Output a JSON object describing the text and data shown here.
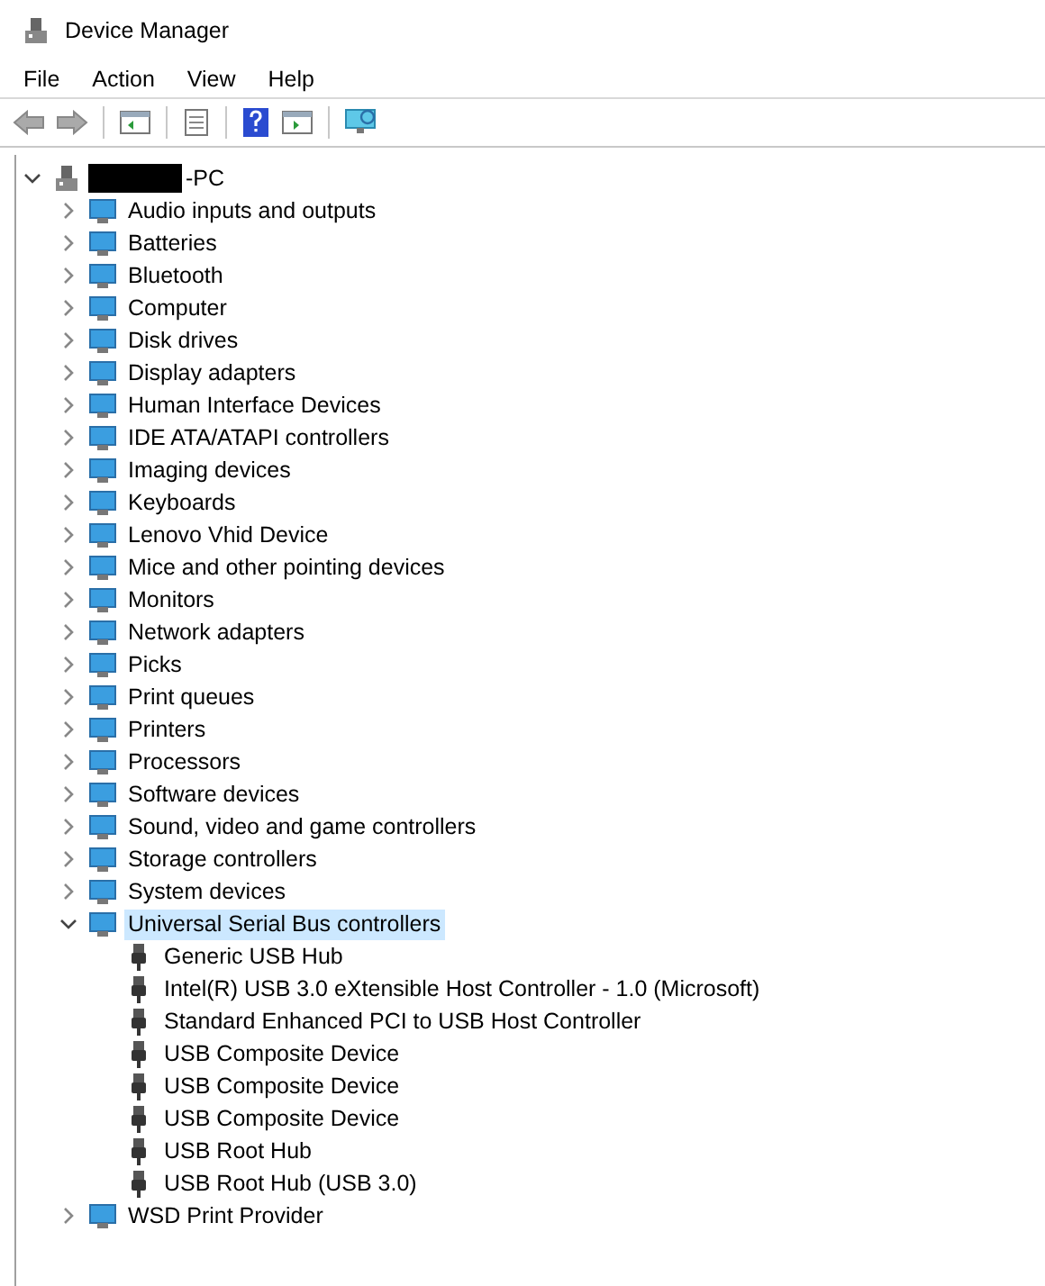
{
  "window": {
    "title": "Device Manager"
  },
  "menu": [
    "File",
    "Action",
    "View",
    "Help"
  ],
  "tree": {
    "label": "-PC",
    "redacted": true,
    "expanded": true,
    "selected": false,
    "children": [
      {
        "label": "Audio inputs and outputs",
        "expanded": false,
        "selected": false
      },
      {
        "label": "Batteries",
        "expanded": false,
        "selected": false
      },
      {
        "label": "Bluetooth",
        "expanded": false,
        "selected": false
      },
      {
        "label": "Computer",
        "expanded": false,
        "selected": false
      },
      {
        "label": "Disk drives",
        "expanded": false,
        "selected": false
      },
      {
        "label": "Display adapters",
        "expanded": false,
        "selected": false
      },
      {
        "label": "Human Interface Devices",
        "expanded": false,
        "selected": false
      },
      {
        "label": "IDE ATA/ATAPI controllers",
        "expanded": false,
        "selected": false
      },
      {
        "label": "Imaging devices",
        "expanded": false,
        "selected": false
      },
      {
        "label": "Keyboards",
        "expanded": false,
        "selected": false
      },
      {
        "label": "Lenovo Vhid Device",
        "expanded": false,
        "selected": false
      },
      {
        "label": "Mice and other pointing devices",
        "expanded": false,
        "selected": false
      },
      {
        "label": "Monitors",
        "expanded": false,
        "selected": false
      },
      {
        "label": "Network adapters",
        "expanded": false,
        "selected": false
      },
      {
        "label": "Picks",
        "expanded": false,
        "selected": false
      },
      {
        "label": "Print queues",
        "expanded": false,
        "selected": false
      },
      {
        "label": "Printers",
        "expanded": false,
        "selected": false
      },
      {
        "label": "Processors",
        "expanded": false,
        "selected": false
      },
      {
        "label": "Software devices",
        "expanded": false,
        "selected": false
      },
      {
        "label": "Sound, video and game controllers",
        "expanded": false,
        "selected": false
      },
      {
        "label": "Storage controllers",
        "expanded": false,
        "selected": false
      },
      {
        "label": "System devices",
        "expanded": false,
        "selected": false
      },
      {
        "label": "Universal Serial Bus controllers",
        "expanded": true,
        "selected": true,
        "children": [
          {
            "label": "Generic USB Hub",
            "selected": false
          },
          {
            "label": "Intel(R) USB 3.0 eXtensible Host Controller - 1.0 (Microsoft)",
            "selected": false
          },
          {
            "label": "Standard Enhanced PCI to USB Host Controller",
            "selected": false
          },
          {
            "label": "USB Composite Device",
            "selected": false
          },
          {
            "label": "USB Composite Device",
            "selected": false
          },
          {
            "label": "USB Composite Device",
            "selected": false
          },
          {
            "label": "USB Root Hub",
            "selected": false
          },
          {
            "label": "USB Root Hub (USB 3.0)",
            "selected": false
          }
        ]
      },
      {
        "label": "WSD Print Provider",
        "expanded": false,
        "selected": false
      }
    ]
  }
}
